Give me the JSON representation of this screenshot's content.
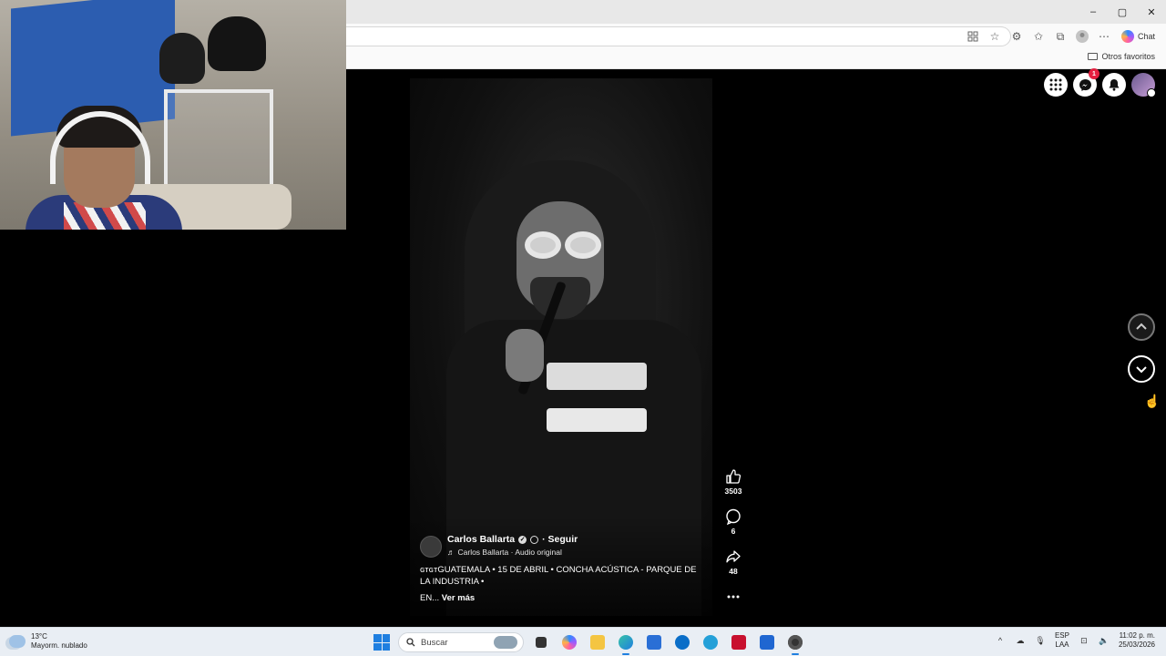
{
  "browser": {
    "window_controls": {
      "minimize": "–",
      "maximize": "▢",
      "close": "✕"
    },
    "chat_label": "Chat",
    "favorites_folder": "Otros favoritos"
  },
  "facebook": {
    "messenger_badge": "1"
  },
  "reel": {
    "author": "Carlos Ballarta",
    "follow_label": "· Seguir",
    "audio_label": "Carlos Ballarta · Audio original",
    "caption": "ɢᴛɢᴛGUATEMALA • 15 DE ABRIL • CONCHA ACÚSTICA - PARQUE DE LA INDUSTRIA •",
    "caption_tail": "EN...",
    "see_more": "Ver más",
    "likes": "3503",
    "comments": "6",
    "shares": "48"
  },
  "taskbar": {
    "temperature": "13°C",
    "weather_desc": "Mayorm. nublado",
    "search_placeholder": "Buscar",
    "lang_top": "ESP",
    "lang_bottom": "LAA",
    "time": "11:02 p. m.",
    "date": "25/03/2026"
  },
  "colors": {
    "accent": "#1f7fe0",
    "badge": "#e41e3f",
    "page_bg": "#000000"
  }
}
